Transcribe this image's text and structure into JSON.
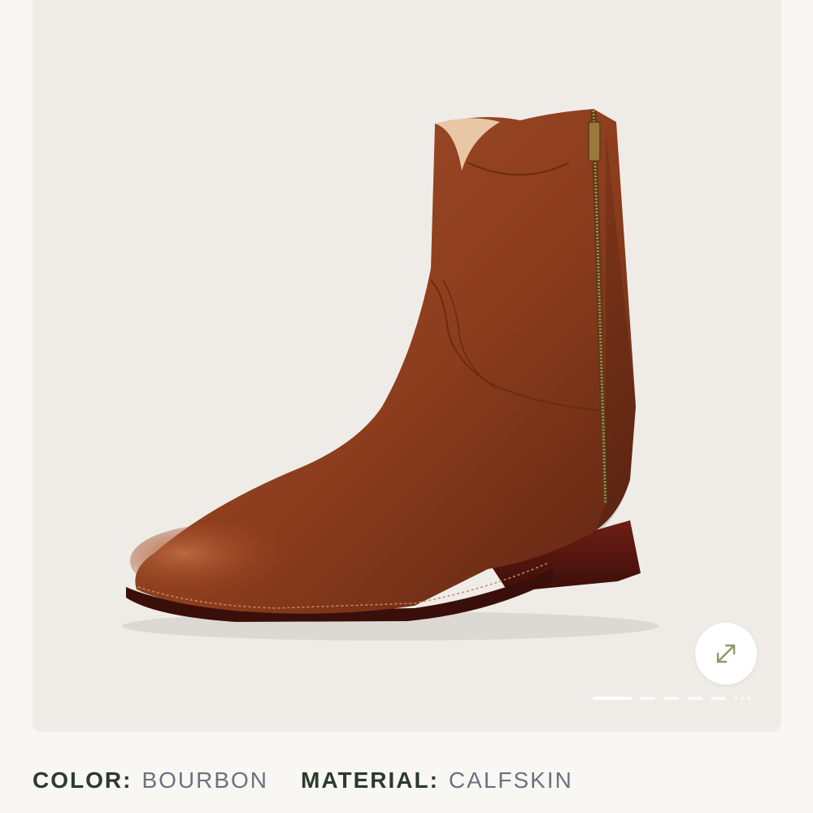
{
  "product_gallery": {
    "image": "brown-leather-zip-boot",
    "expand_icon": "expand-arrows-icon",
    "slides_total": 6,
    "active_slide": 1
  },
  "attributes": [
    {
      "label": "COLOR:",
      "value": "BOURBON"
    },
    {
      "label": "MATERIAL:",
      "value": "CALFSKIN"
    }
  ],
  "colors": {
    "page_background": "#f8f7f3",
    "gallery_background": "#efece7",
    "label_color": "#2c3a2c",
    "value_color": "#6b7280",
    "icon_color": "#8a9a6a"
  }
}
